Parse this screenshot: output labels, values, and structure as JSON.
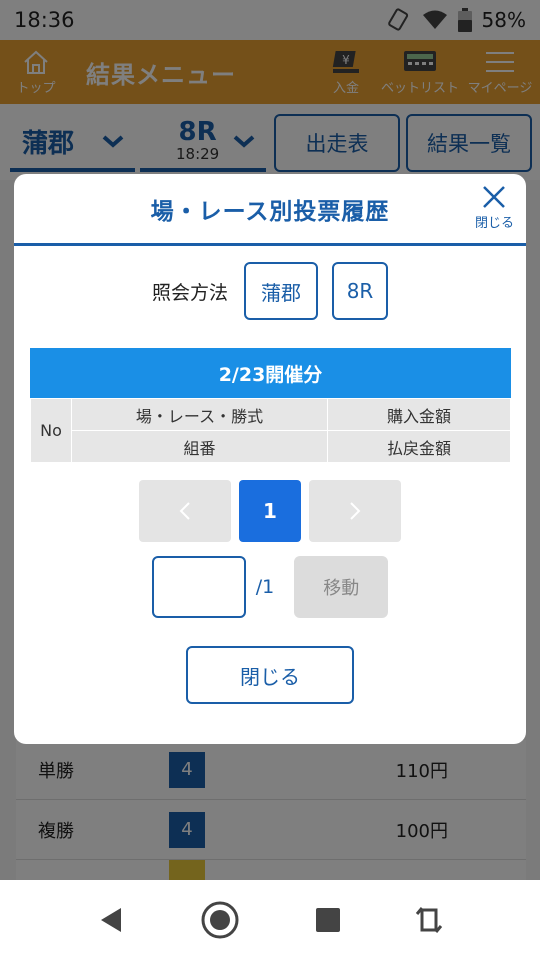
{
  "status": {
    "time": "18:36",
    "battery": "58%"
  },
  "header": {
    "home_label": "トップ",
    "title": "結果メニュー",
    "deposit_label": "入金",
    "betlist_label": "ベットリスト",
    "mypage_label": "マイページ"
  },
  "subheader": {
    "venue": "蒲郡",
    "race": "8R",
    "race_time": "18:29",
    "entry_label": "出走表",
    "results_label": "結果一覧"
  },
  "background": {
    "rows": [
      {
        "label": "単勝",
        "number": "4",
        "payout": "110円"
      },
      {
        "label": "複勝",
        "number": "4",
        "payout": "100円"
      }
    ]
  },
  "modal": {
    "title": "場・レース別投票履歴",
    "close_icon_label": "閉じる",
    "query_label": "照会方法",
    "query_venue": "蒲郡",
    "query_race": "8R",
    "date_header": "2/23開催分",
    "table": {
      "no_label": "No",
      "col1_top": "場・レース・勝式",
      "col2_top": "購入金額",
      "col1_bottom": "組番",
      "col2_bottom": "払戻金額"
    },
    "pager": {
      "current": "1",
      "total": "/1",
      "jump_label": "移動",
      "jump_value": ""
    },
    "close_label": "閉じる"
  }
}
